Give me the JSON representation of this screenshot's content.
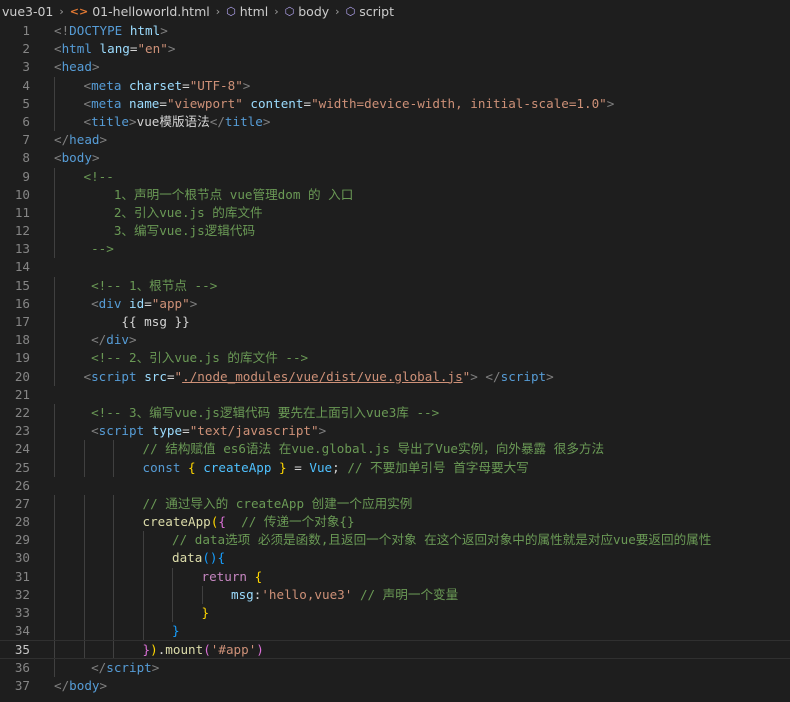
{
  "breadcrumb": {
    "folder": "vue3-01",
    "file": "01-helloworld.html",
    "path": [
      "html",
      "body",
      "script"
    ]
  },
  "editor": {
    "current_line": 35,
    "lines": [
      {
        "n": "1",
        "indent": 0,
        "tokens": [
          [
            "tag",
            "<!"
          ],
          [
            "name",
            "DOCTYPE"
          ],
          [
            "text",
            " "
          ],
          [
            "attr",
            "html"
          ],
          [
            "tag",
            ">"
          ]
        ]
      },
      {
        "n": "2",
        "indent": 0,
        "tokens": [
          [
            "tag",
            "<"
          ],
          [
            "name",
            "html"
          ],
          [
            "text",
            " "
          ],
          [
            "attr",
            "lang"
          ],
          [
            "text",
            "="
          ],
          [
            "str",
            "\"en\""
          ],
          [
            "tag",
            ">"
          ]
        ]
      },
      {
        "n": "3",
        "indent": 0,
        "tokens": [
          [
            "tag",
            "<"
          ],
          [
            "name",
            "head"
          ],
          [
            "tag",
            ">"
          ]
        ]
      },
      {
        "n": "4",
        "indent": 1,
        "tokens": [
          [
            "tag",
            "<"
          ],
          [
            "name",
            "meta"
          ],
          [
            "text",
            " "
          ],
          [
            "attr",
            "charset"
          ],
          [
            "text",
            "="
          ],
          [
            "str",
            "\"UTF-8\""
          ],
          [
            "tag",
            ">"
          ]
        ]
      },
      {
        "n": "5",
        "indent": 1,
        "tokens": [
          [
            "tag",
            "<"
          ],
          [
            "name",
            "meta"
          ],
          [
            "text",
            " "
          ],
          [
            "attr",
            "name"
          ],
          [
            "text",
            "="
          ],
          [
            "str",
            "\"viewport\""
          ],
          [
            "text",
            " "
          ],
          [
            "attr",
            "content"
          ],
          [
            "text",
            "="
          ],
          [
            "str",
            "\"width=device-width, initial-scale=1.0\""
          ],
          [
            "tag",
            ">"
          ]
        ]
      },
      {
        "n": "6",
        "indent": 1,
        "tokens": [
          [
            "tag",
            "<"
          ],
          [
            "name",
            "title"
          ],
          [
            "tag",
            ">"
          ],
          [
            "text",
            "vue模版语法"
          ],
          [
            "tag",
            "</"
          ],
          [
            "name",
            "title"
          ],
          [
            "tag",
            ">"
          ]
        ]
      },
      {
        "n": "7",
        "indent": 0,
        "tokens": [
          [
            "tag",
            "</"
          ],
          [
            "name",
            "head"
          ],
          [
            "tag",
            ">"
          ]
        ]
      },
      {
        "n": "8",
        "indent": 0,
        "tokens": [
          [
            "tag",
            "<"
          ],
          [
            "name",
            "body"
          ],
          [
            "tag",
            ">"
          ]
        ]
      },
      {
        "n": "9",
        "indent": 1,
        "tokens": [
          [
            "com",
            "<!--"
          ]
        ]
      },
      {
        "n": "10",
        "indent": 1,
        "tokens": [
          [
            "com",
            "    1、声明一个根节点 vue管理dom 的 入口"
          ]
        ]
      },
      {
        "n": "11",
        "indent": 1,
        "tokens": [
          [
            "com",
            "    2、引入vue.js 的库文件"
          ]
        ]
      },
      {
        "n": "12",
        "indent": 1,
        "tokens": [
          [
            "com",
            "    3、编写vue.js逻辑代码"
          ]
        ]
      },
      {
        "n": "13",
        "indent": 1,
        "tokens": [
          [
            "com",
            " -->"
          ]
        ]
      },
      {
        "n": "14",
        "indent": 0,
        "tokens": []
      },
      {
        "n": "15",
        "indent": 1,
        "tokens": [
          [
            "com",
            " <!-- 1、根节点 -->"
          ]
        ]
      },
      {
        "n": "16",
        "indent": 1,
        "tokens": [
          [
            "tag",
            " <"
          ],
          [
            "name",
            "div"
          ],
          [
            "text",
            " "
          ],
          [
            "attr",
            "id"
          ],
          [
            "text",
            "="
          ],
          [
            "str",
            "\"app\""
          ],
          [
            "tag",
            ">"
          ]
        ]
      },
      {
        "n": "17",
        "indent": 1,
        "tokens": [
          [
            "text",
            "     {{ msg }}"
          ]
        ]
      },
      {
        "n": "18",
        "indent": 1,
        "tokens": [
          [
            "tag",
            " </"
          ],
          [
            "name",
            "div"
          ],
          [
            "tag",
            ">"
          ]
        ]
      },
      {
        "n": "19",
        "indent": 1,
        "tokens": [
          [
            "com",
            " <!-- 2、引入vue.js 的库文件 -->"
          ]
        ]
      },
      {
        "n": "20",
        "indent": 1,
        "tokens": [
          [
            "tag",
            "<"
          ],
          [
            "name",
            "script"
          ],
          [
            "text",
            " "
          ],
          [
            "attr",
            "src"
          ],
          [
            "text",
            "="
          ],
          [
            "str",
            "\""
          ],
          [
            "src",
            "./node_modules/vue/dist/vue.global.js"
          ],
          [
            "str",
            "\""
          ],
          [
            "tag",
            "> </"
          ],
          [
            "name",
            "script"
          ],
          [
            "tag",
            ">"
          ]
        ]
      },
      {
        "n": "21",
        "indent": 0,
        "tokens": []
      },
      {
        "n": "22",
        "indent": 1,
        "tokens": [
          [
            "com",
            " <!-- 3、编写vue.js逻辑代码 要先在上面引入vue3库 -->"
          ]
        ]
      },
      {
        "n": "23",
        "indent": 1,
        "tokens": [
          [
            "tag",
            " <"
          ],
          [
            "name",
            "script"
          ],
          [
            "text",
            " "
          ],
          [
            "attr",
            "type"
          ],
          [
            "text",
            "="
          ],
          [
            "str",
            "\"text/javascript\""
          ],
          [
            "tag",
            ">"
          ]
        ]
      },
      {
        "n": "24",
        "indent": 3,
        "tokens": [
          [
            "com",
            "// 结构赋值 es6语法 在vue.global.js 导出了Vue实例，向外暴露 很多方法"
          ]
        ]
      },
      {
        "n": "25",
        "indent": 3,
        "tokens": [
          [
            "kw",
            "const"
          ],
          [
            "text",
            " "
          ],
          [
            "b1",
            "{"
          ],
          [
            "text",
            " "
          ],
          [
            "var",
            "createApp"
          ],
          [
            "text",
            " "
          ],
          [
            "b1",
            "}"
          ],
          [
            "text",
            " = "
          ],
          [
            "var",
            "Vue"
          ],
          [
            "text",
            "; "
          ],
          [
            "com",
            "// 不要加单引号 首字母要大写"
          ]
        ]
      },
      {
        "n": "26",
        "indent": 0,
        "tokens": []
      },
      {
        "n": "27",
        "indent": 3,
        "tokens": [
          [
            "com",
            "// 通过导入的 createApp 创建一个应用实例"
          ]
        ]
      },
      {
        "n": "28",
        "indent": 3,
        "tokens": [
          [
            "fn",
            "createApp"
          ],
          [
            "b1",
            "("
          ],
          [
            "b2",
            "{"
          ],
          [
            "text",
            "  "
          ],
          [
            "com",
            "// 传递一个对象{}"
          ]
        ]
      },
      {
        "n": "29",
        "indent": 4,
        "tokens": [
          [
            "com",
            "// data选项 必须是函数,且返回一个对象 在这个返回对象中的属性就是对应vue要返回的属性"
          ]
        ]
      },
      {
        "n": "30",
        "indent": 4,
        "tokens": [
          [
            "fn",
            "data"
          ],
          [
            "b3",
            "()"
          ],
          [
            "b3",
            "{"
          ]
        ]
      },
      {
        "n": "31",
        "indent": 5,
        "tokens": [
          [
            "ctl",
            "return"
          ],
          [
            "text",
            " "
          ],
          [
            "b1",
            "{"
          ]
        ]
      },
      {
        "n": "32",
        "indent": 6,
        "tokens": [
          [
            "prop",
            "msg"
          ],
          [
            "text",
            ":"
          ],
          [
            "str",
            "'hello,vue3'"
          ],
          [
            "text",
            " "
          ],
          [
            "com",
            "// 声明一个变量"
          ]
        ]
      },
      {
        "n": "33",
        "indent": 5,
        "tokens": [
          [
            "b1",
            "}"
          ]
        ]
      },
      {
        "n": "34",
        "indent": 4,
        "tokens": [
          [
            "b3",
            "}"
          ]
        ]
      },
      {
        "n": "35",
        "indent": 3,
        "tokens": [
          [
            "b2",
            "}"
          ],
          [
            "b1",
            ")"
          ],
          [
            "text",
            "."
          ],
          [
            "fn",
            "mount"
          ],
          [
            "b2",
            "("
          ],
          [
            "str",
            "'#app'"
          ],
          [
            "b2",
            ")"
          ]
        ]
      },
      {
        "n": "36",
        "indent": 1,
        "tokens": [
          [
            "tag",
            " </"
          ],
          [
            "name",
            "script"
          ],
          [
            "tag",
            ">"
          ]
        ]
      },
      {
        "n": "37",
        "indent": 0,
        "tokens": [
          [
            "tag",
            "</"
          ],
          [
            "name",
            "body"
          ],
          [
            "tag",
            ">"
          ]
        ]
      }
    ]
  }
}
